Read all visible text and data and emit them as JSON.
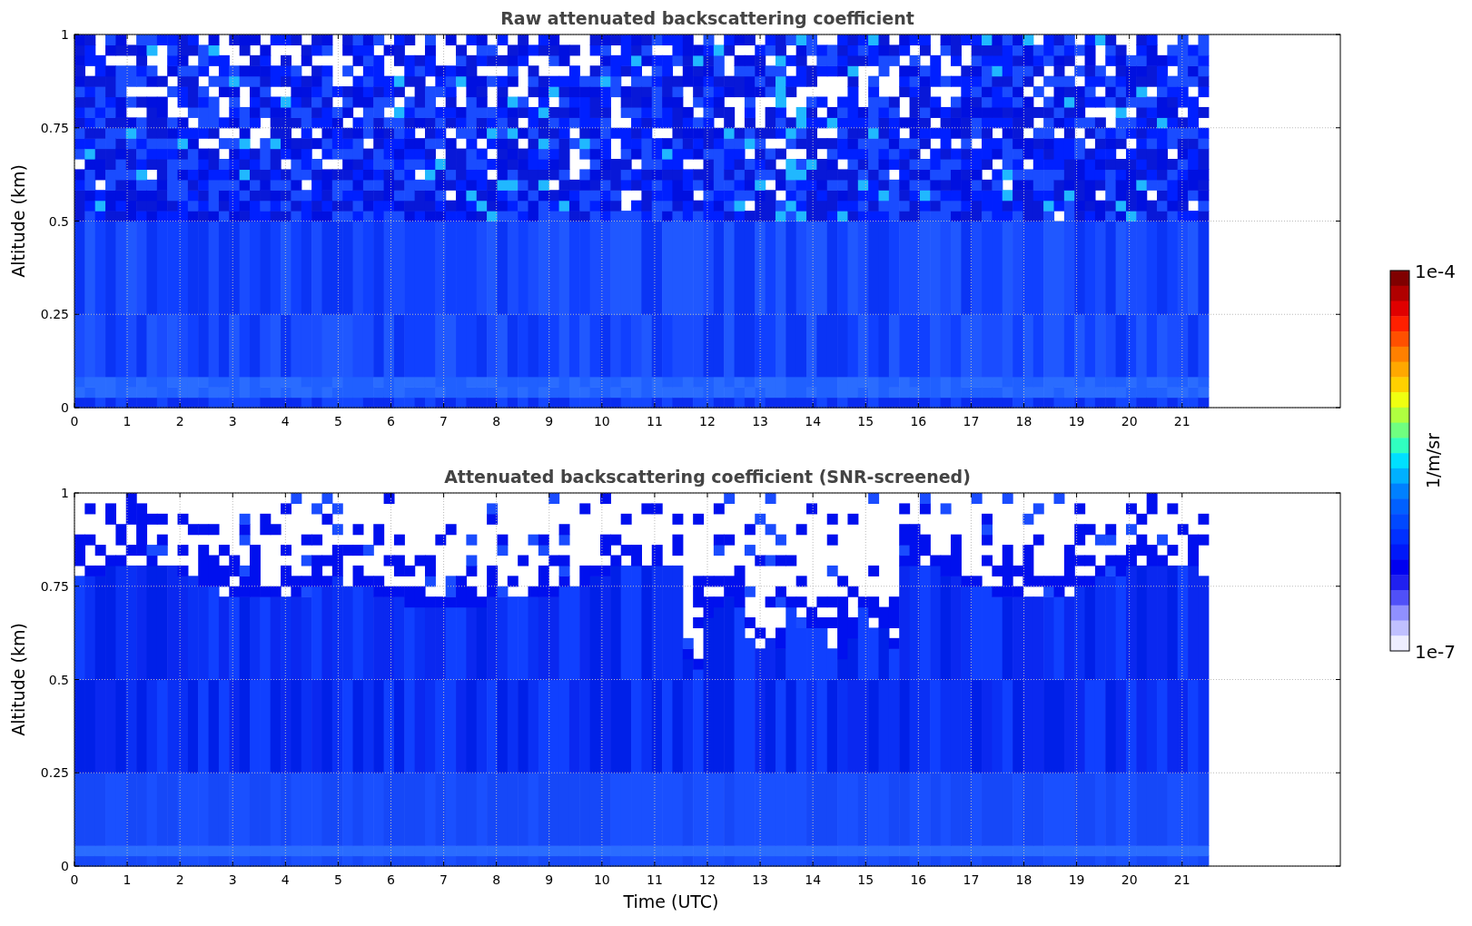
{
  "panels": [
    {
      "kind": "raw",
      "title": "Raw attenuated backscattering coefficient",
      "ylabel": "Altitude (km)",
      "yticks": [
        "1",
        "0.75",
        "0.5",
        "0.25",
        "0"
      ],
      "xticks": [
        "0",
        "1",
        "2",
        "3",
        "4",
        "5",
        "6",
        "7",
        "8",
        "9",
        "10",
        "11",
        "12",
        "13",
        "14",
        "15",
        "16",
        "17",
        "18",
        "19",
        "20",
        "21"
      ]
    },
    {
      "kind": "screened",
      "title": "Attenuated backscattering coefficient (SNR-screened)",
      "ylabel": "Altitude (km)",
      "yticks": [
        "1",
        "0.75",
        "0.5",
        "0.25",
        "0"
      ],
      "xticks": [
        "0",
        "1",
        "2",
        "3",
        "4",
        "5",
        "6",
        "7",
        "8",
        "9",
        "10",
        "11",
        "12",
        "13",
        "14",
        "15",
        "16",
        "17",
        "18",
        "19",
        "20",
        "21"
      ],
      "xlabel": "Time (UTC)"
    }
  ],
  "colorbar": {
    "max_label": "1e-4",
    "min_label": "1e-7",
    "label": "1/m/sr"
  }
}
